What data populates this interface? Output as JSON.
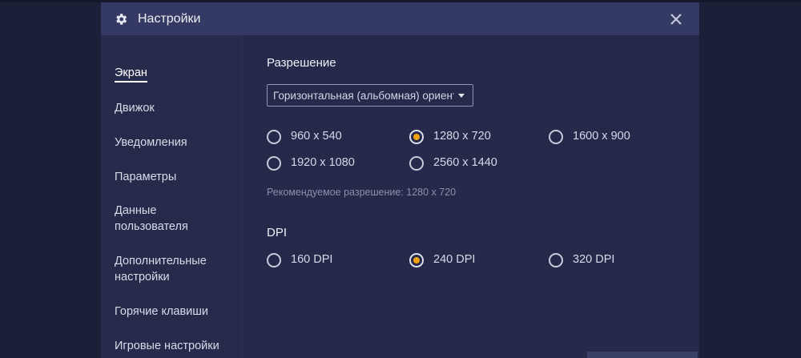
{
  "window": {
    "title": "Настройки",
    "icons": {
      "title": "gear-icon",
      "close": "close-icon"
    }
  },
  "sidebar": {
    "items": [
      {
        "label": "Экран",
        "active": true
      },
      {
        "label": "Движок"
      },
      {
        "label": "Уведомления"
      },
      {
        "label": "Параметры"
      },
      {
        "label": "Данные пользователя"
      },
      {
        "label": "Дополнительные настройки"
      },
      {
        "label": "Горячие клавиши"
      },
      {
        "label": "Игровые настройки"
      }
    ]
  },
  "resolution": {
    "heading": "Разрешение",
    "orientation_value": "Горизонтальная (альбомная) ориентация",
    "options": [
      {
        "label": "960 x 540",
        "selected": false
      },
      {
        "label": "1280 x 720",
        "selected": true
      },
      {
        "label": "1600 x 900",
        "selected": false
      },
      {
        "label": "1920 x 1080",
        "selected": false
      },
      {
        "label": "2560 x 1440",
        "selected": false
      }
    ],
    "recommended": "Рекомендуемое разрешение: 1280 x 720"
  },
  "dpi": {
    "heading": "DPI",
    "options": [
      {
        "label": "160 DPI",
        "selected": false
      },
      {
        "label": "240 DPI",
        "selected": true
      },
      {
        "label": "320 DPI",
        "selected": false
      }
    ]
  },
  "colors": {
    "background": "#1c1f38",
    "window": "#252a4b",
    "titlebar": "#343a63",
    "accent": "#f2a112"
  }
}
